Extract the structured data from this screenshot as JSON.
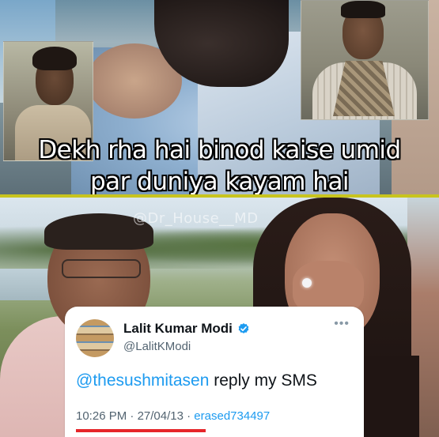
{
  "meme": {
    "caption_line1": "Dekh rha hai binod kaise umid",
    "caption_line2": "par duniya kayam hai",
    "watermark": "@Dr_House__MD",
    "divider_color": "#c8c41e"
  },
  "tweet": {
    "display_name": "Lalit Kumar Modi",
    "handle": "@LalitKModi",
    "mention": "@thesushmitasen",
    "message": " reply my SMS",
    "time": "10:26 PM",
    "separator1": " · ",
    "date": "27/04/13",
    "separator2": " · ",
    "source": "erased734497",
    "more_icon": "more-horizontal-icon",
    "verified_icon": "verified-badge-icon",
    "accent_color": "#1d9bf0",
    "underline_color": "#e6262a"
  }
}
